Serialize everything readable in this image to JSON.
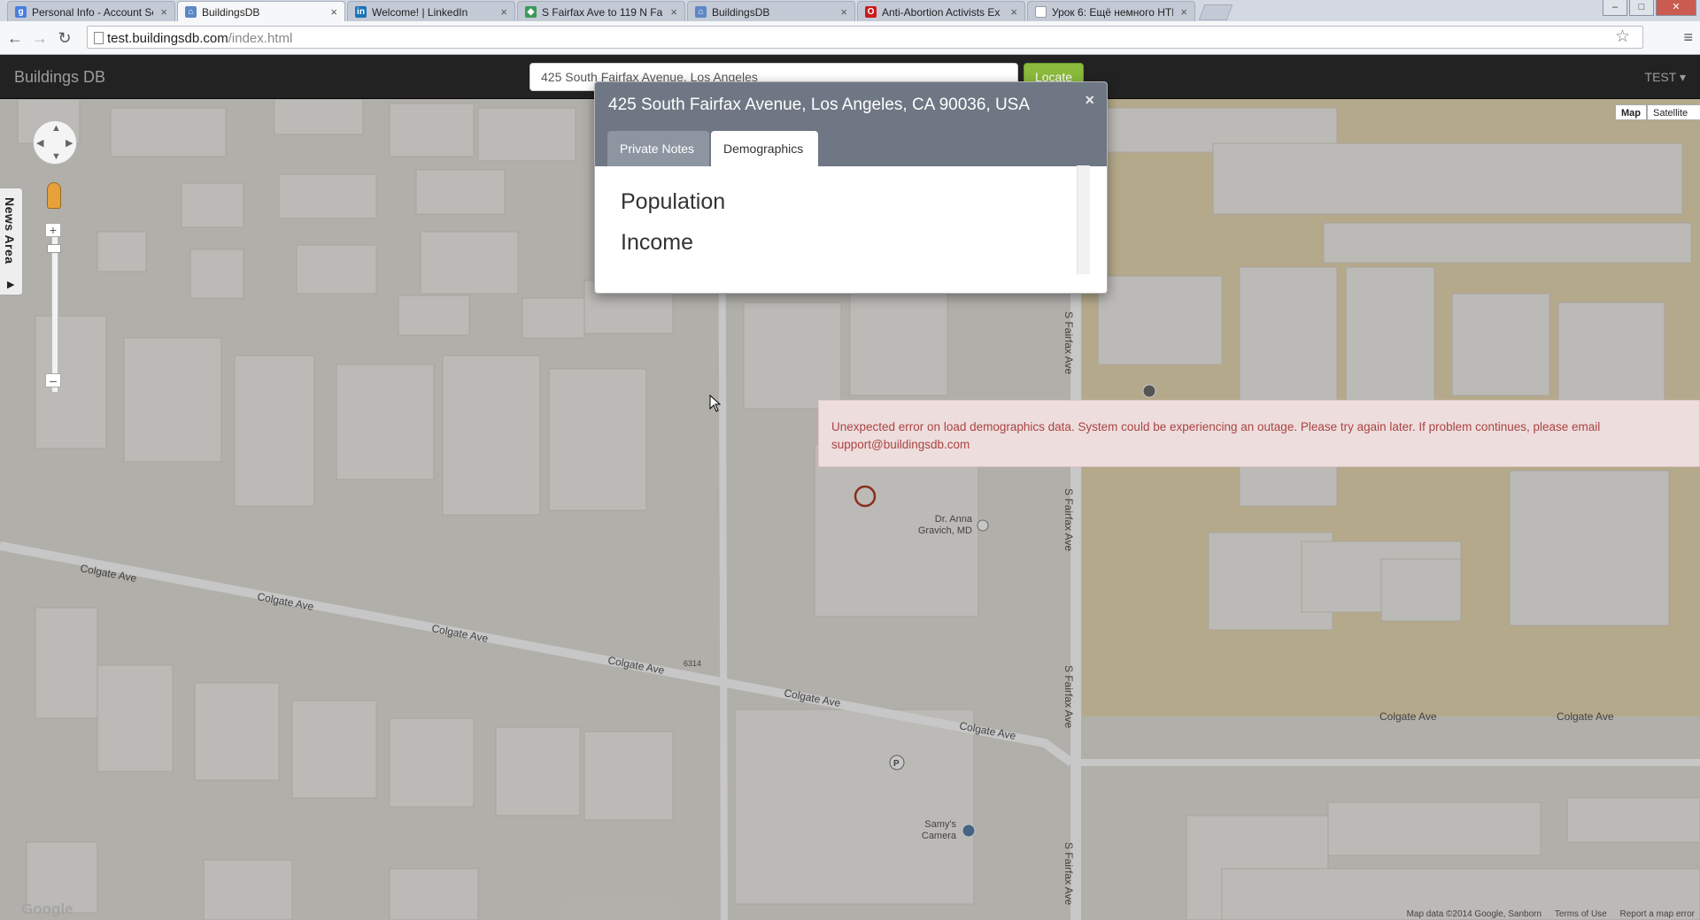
{
  "browser": {
    "tabs": [
      {
        "title": "Personal Info - Account Se",
        "icon": "google-icon",
        "color": "#4a7de0"
      },
      {
        "title": "BuildingsDB",
        "icon": "buildingsdb-icon",
        "color": "#5c87c6",
        "active": true
      },
      {
        "title": "Welcome! | LinkedIn",
        "icon": "linkedin-icon",
        "color": "#1a73b8"
      },
      {
        "title": "S Fairfax Ave to 119 N Fair",
        "icon": "maps-icon",
        "color": "#3b9a57"
      },
      {
        "title": "BuildingsDB",
        "icon": "buildingsdb-icon",
        "color": "#5c87c6"
      },
      {
        "title": "Anti-Abortion Activists Ex",
        "icon": "opera-icon",
        "color": "#cc1b1b"
      },
      {
        "title": "Урок 6: Ещё немного HTM",
        "icon": "page-icon",
        "color": "#999999"
      }
    ],
    "url_host": "test.buildingsdb.com",
    "url_path": "/index.html"
  },
  "app": {
    "brand": "Buildings DB",
    "search_value": "425 South Fairfax Avenue, Los Angeles",
    "locate_label": "Locate",
    "user_label": "TEST ▾"
  },
  "modal": {
    "title": "425 South Fairfax Avenue, Los Angeles, CA 90036, USA",
    "close": "×",
    "tabs": {
      "private": "Private Notes",
      "demographics": "Demographics"
    },
    "sections": {
      "population": "Population",
      "income": "Income"
    }
  },
  "alert": {
    "message": "Unexpected error on load demographics data. System could be experiencing an outage. Please try again later. If problem continues, please email support@buildingsdb.com"
  },
  "map": {
    "map_type": {
      "map": "Map",
      "satellite": "Satellite"
    },
    "streets": {
      "colgate": "Colgate Ave",
      "fairfax": "S Fairfax Ave"
    },
    "places": {
      "doctor_line1": "Dr. Anna",
      "doctor_line2": "Gravich, MD",
      "camera_line1": "Samy's",
      "camera_line2": "Camera",
      "parking": "P",
      "number": "6314"
    },
    "logo": "Google",
    "attribution": {
      "data": "Map data ©2014 Google, Sanborn",
      "terms": "Terms of Use",
      "report": "Report a map error"
    },
    "news_area": "News Area"
  }
}
